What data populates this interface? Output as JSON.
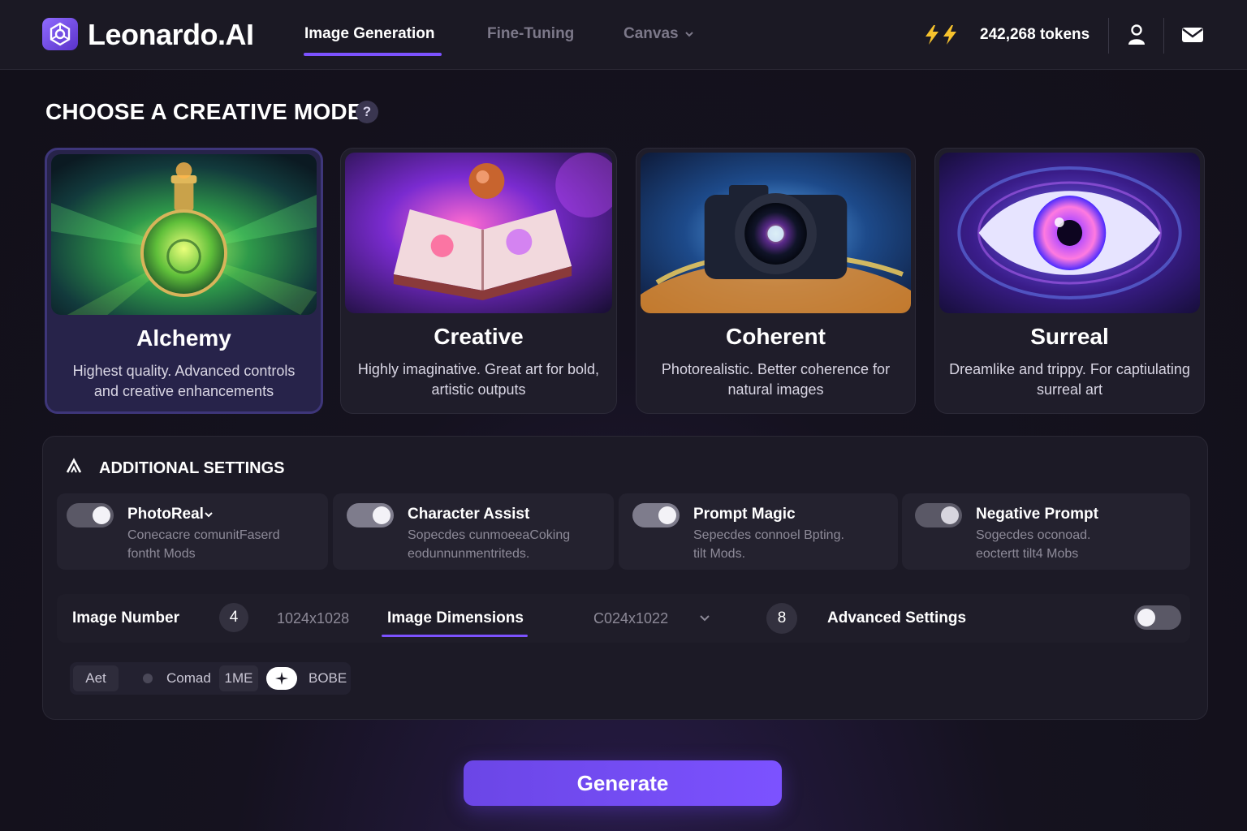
{
  "app": {
    "brand": "Leonardo.AI",
    "nav": [
      {
        "label": "Image Generation",
        "active": true
      },
      {
        "label": "Fine-Tuning",
        "active": false
      },
      {
        "label": "Canvas",
        "active": false
      }
    ],
    "tokens": "242,268 tokens"
  },
  "heading": "CHOOSE A CREATIVE MODE",
  "help_symbol": "?",
  "modes": [
    {
      "title": "Alchemy",
      "desc": "Highest quality. Advanced controls and creative enhancements",
      "selected": true
    },
    {
      "title": "Creative",
      "desc": "Highly imaginative. Great art for bold, artistic outputs",
      "selected": false
    },
    {
      "title": "Coherent",
      "desc": "Photorealistic. Better coherence for natural images",
      "selected": false
    },
    {
      "title": "Surreal",
      "desc": "Dreamlike and trippy. For captiulating surreal art",
      "selected": false
    }
  ],
  "settings": {
    "title": "ADDITIONAL SETTINGS",
    "options": [
      {
        "title": "PhotoReal",
        "desc_line1": "Conecacre comunitFaserd",
        "desc_line2": "fontht Mods",
        "on": false
      },
      {
        "title": "Character Assist",
        "desc_line1": "Sopecdes cunmoeeaCoking",
        "desc_line2": "eodunnunmentriteds.",
        "on": true
      },
      {
        "title": "Prompt Magic",
        "desc_line1": "Sepecdes connoel Bpting.",
        "desc_line2": "tilt Mods.",
        "on": true
      },
      {
        "title": "Negative Prompt",
        "desc_line1": "Sogecdes oconoad.",
        "desc_line2": "eoctertt tilt4 Mobs",
        "on": false
      }
    ],
    "image_number_label": "Image Number",
    "image_number_value": "4",
    "image_size_text": "1024x1028",
    "image_dimensions_label": "Image Dimensions",
    "dimension_value": "C024x1022",
    "dimension_count": "8",
    "advanced_label": "Advanced Settings",
    "advanced_on": false,
    "chips": {
      "aspect": "Aet",
      "control": "Comad",
      "size_a": "1ME",
      "size_b": "BOBE"
    }
  },
  "generate_label": "Generate",
  "colors": {
    "accent": "#7c52ff",
    "background": "#15121f",
    "card": "#1f1d2a",
    "card_selected": "#27234a",
    "bolt": "#f6c22d"
  },
  "icons": {
    "logo": "logo-mark-icon",
    "tokens": "lightning-bolt-icon",
    "user": "user-icon",
    "inbox": "mail-icon",
    "settings": "chevron-up-icon"
  }
}
